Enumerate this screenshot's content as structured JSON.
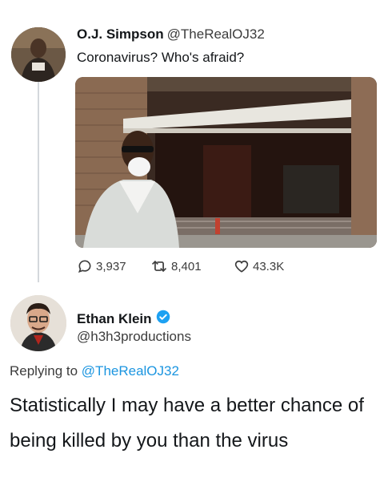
{
  "tweet1": {
    "author_name": "O.J. Simpson",
    "author_handle": "@TheRealOJ32",
    "text": "Coronavirus? Who's afraid?",
    "replies": "3,937",
    "retweets": "8,401",
    "likes": "43.3K"
  },
  "tweet2": {
    "author_name": "Ethan Klein",
    "author_handle": "@h3h3productions",
    "replying_prefix": "Replying to",
    "replying_to": "@TheRealOJ32",
    "text": "Statistically I may have a better chance of being killed by you than the virus"
  },
  "colors": {
    "link": "#1b95e0",
    "verified": "#1da1f2",
    "muted": "#3c3c3c",
    "thread_line": "#d4d8dc"
  },
  "icons": [
    "reply-icon",
    "retweet-icon",
    "like-icon",
    "verified-badge-icon"
  ]
}
